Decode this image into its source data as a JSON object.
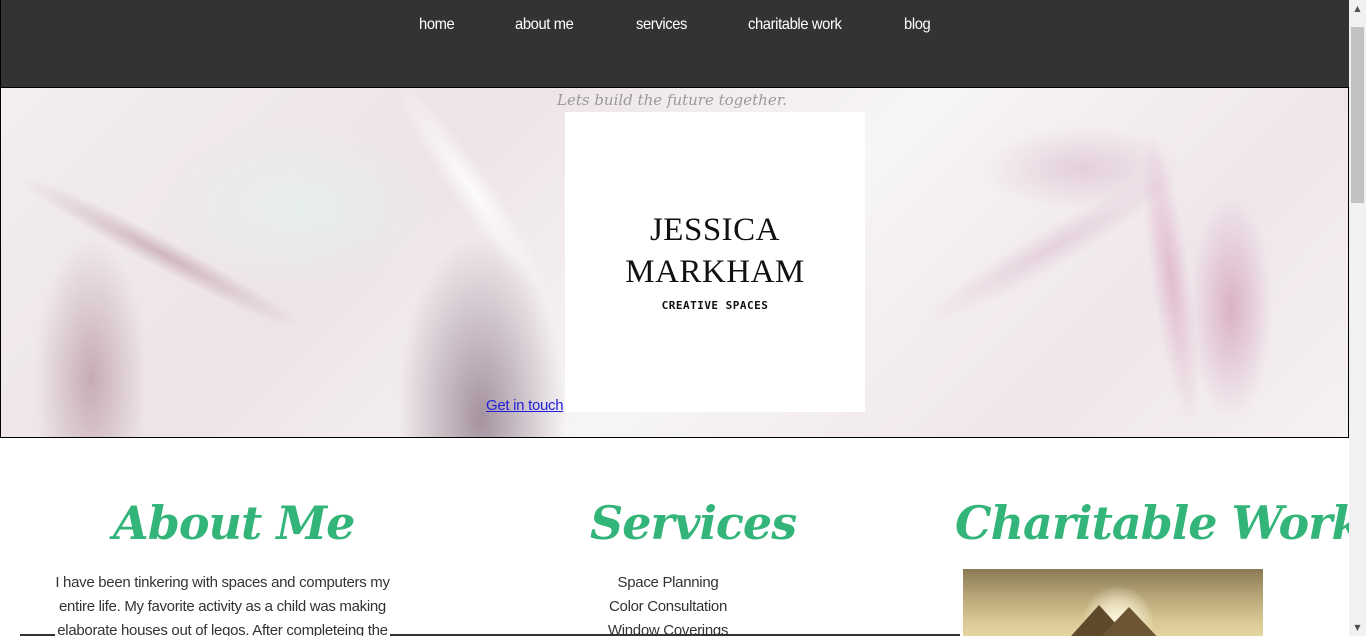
{
  "nav": {
    "items": [
      {
        "label": "home"
      },
      {
        "label": "about me"
      },
      {
        "label": "services"
      },
      {
        "label": "charitable work"
      },
      {
        "label": "blog"
      }
    ]
  },
  "hero": {
    "tagline": "Lets build the future together.",
    "logo": {
      "line1": "JESSICA",
      "line2": "MARKHAM",
      "subtitle": "CREATIVE SPACES"
    },
    "cta_label": "Get in touch"
  },
  "about": {
    "heading": "About Me",
    "text": "I have been tinkering with spaces and computers my entire life. My favorite activity as a child was making elaborate houses out of legos. After completeing the"
  },
  "services": {
    "heading": "Services",
    "items": [
      "Space Planning",
      "Color Consultation",
      "Window Coverings"
    ]
  },
  "charitable": {
    "heading": "Charitable Work"
  },
  "colors": {
    "nav_bg": "#333333",
    "heading_green": "#33b57a",
    "link_blue": "#1f1fd8"
  }
}
